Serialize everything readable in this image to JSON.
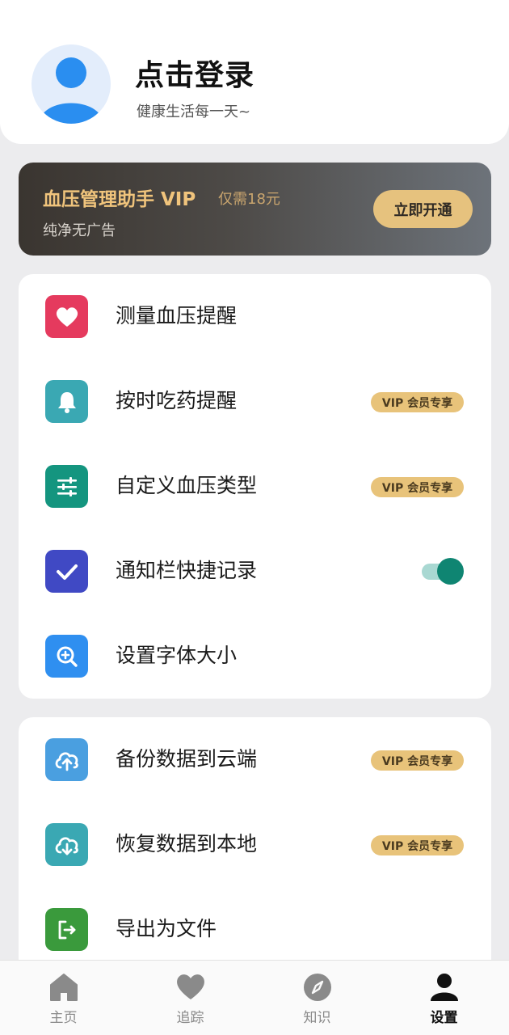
{
  "profile": {
    "login_title": "点击登录",
    "subtitle": "健康生活每一天~"
  },
  "vip": {
    "title": "血压管理助手 VIP",
    "price": "仅需18元",
    "subtitle": "纯净无广告",
    "button": "立即开通"
  },
  "settings_group1": [
    {
      "label": "测量血压提醒",
      "icon": "heart-icon",
      "color": "#e53a5e"
    },
    {
      "label": "按时吃药提醒",
      "icon": "bell-icon",
      "color": "#3aa8b3",
      "badge": "VIP 会员专享"
    },
    {
      "label": "自定义血压类型",
      "icon": "sliders-icon",
      "color": "#14957f",
      "badge": "VIP 会员专享"
    },
    {
      "label": "通知栏快捷记录",
      "icon": "check-icon",
      "color": "#4049c4",
      "toggle_on": true
    },
    {
      "label": "设置字体大小",
      "icon": "zoom-in-icon",
      "color": "#2f8ff0"
    }
  ],
  "settings_group2": [
    {
      "label": "备份数据到云端",
      "icon": "cloud-upload-icon",
      "color": "#4a9fe0",
      "badge": "VIP 会员专享"
    },
    {
      "label": "恢复数据到本地",
      "icon": "cloud-download-icon",
      "color": "#3aa8b3",
      "badge": "VIP 会员专享"
    },
    {
      "label": "导出为文件",
      "icon": "export-icon",
      "color": "#3a9a3c"
    }
  ],
  "tabs": [
    {
      "label": "主页",
      "icon": "home-icon",
      "active": false
    },
    {
      "label": "追踪",
      "icon": "heart-icon",
      "active": false
    },
    {
      "label": "知识",
      "icon": "compass-icon",
      "active": false
    },
    {
      "label": "设置",
      "icon": "user-icon",
      "active": true
    }
  ]
}
